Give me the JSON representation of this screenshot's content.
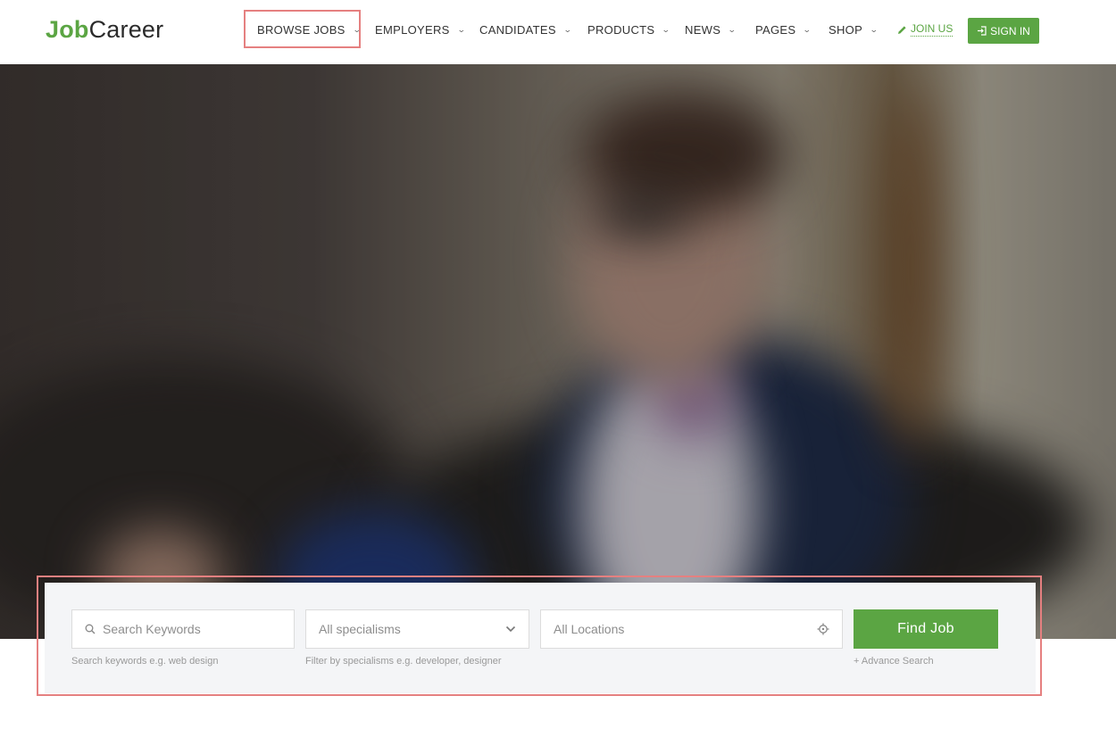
{
  "brand": {
    "logo_part1": "Job",
    "logo_part2": "Career",
    "accent_color": "#5ba543"
  },
  "nav": {
    "items": [
      {
        "label": "BROWSE JOBS",
        "highlighted": true
      },
      {
        "label": "EMPLOYERS"
      },
      {
        "label": "CANDIDATES"
      },
      {
        "label": "PRODUCTS"
      },
      {
        "label": "NEWS"
      },
      {
        "label": "PAGES"
      },
      {
        "label": "SHOP"
      }
    ],
    "join_label": "JOIN US",
    "signin_label": "SIGN IN",
    "icons": {
      "dropdown": "chevron-down-icon",
      "join": "pencil-icon",
      "signin": "sign-in-icon"
    }
  },
  "search": {
    "keywords_placeholder": "Search Keywords",
    "keywords_hint": "Search keywords e.g. web design",
    "specialism_value": "All specialisms",
    "specialism_hint": "Filter by specialisms e.g. developer, designer",
    "location_placeholder": "All Locations",
    "find_label": "Find Job",
    "advance_label": "+ Advance Search",
    "icons": {
      "keywords": "search-icon",
      "specialism": "chevron-down-icon",
      "location": "crosshair-icon"
    }
  }
}
